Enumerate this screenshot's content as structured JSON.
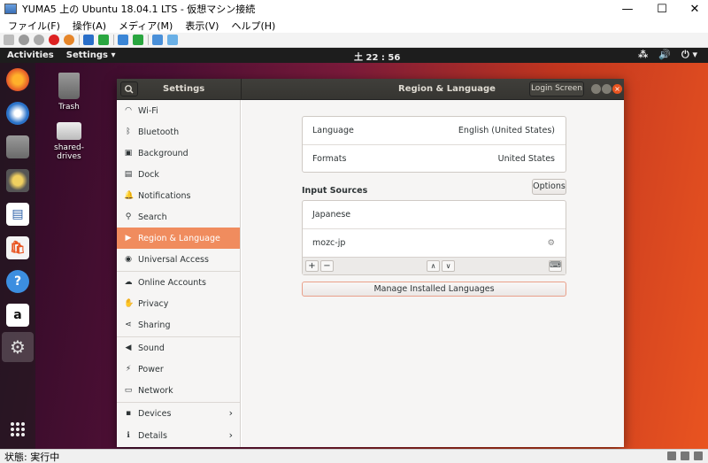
{
  "host": {
    "title": "YUMA5 上の Ubuntu 18.04.1 LTS - 仮想マシン接続",
    "menu": [
      "ファイル(F)",
      "操作(A)",
      "メディア(M)",
      "表示(V)",
      "ヘルプ(H)"
    ],
    "status": "状態: 実行中",
    "window_controls": {
      "minimize": "—",
      "maximize": "☐",
      "close": "✕"
    }
  },
  "topbar": {
    "activities": "Activities",
    "app_menu": "Settings ▾",
    "clock": "土 22 : 56",
    "tray_icons": [
      "network-icon",
      "volume-icon",
      "power-icon"
    ],
    "tray_glyphs": [
      "⁂",
      "🔊",
      "⏻ ▾"
    ]
  },
  "desktop_icons": [
    {
      "name": "trash",
      "label": "Trash"
    },
    {
      "name": "shared-drives",
      "label": "shared-\ndrives"
    }
  ],
  "settings": {
    "header_title": "Settings",
    "panel_title": "Region & Language",
    "login_screen_button": "Login Screen",
    "sidebar": [
      {
        "label": "Wi-Fi",
        "icon": "wifi-icon",
        "glyph": "◠"
      },
      {
        "label": "Bluetooth",
        "icon": "bluetooth-icon",
        "glyph": "ᛒ"
      },
      {
        "label": "Background",
        "icon": "background-icon",
        "glyph": "▣"
      },
      {
        "label": "Dock",
        "icon": "dock-icon",
        "glyph": "▤"
      },
      {
        "label": "Notifications",
        "icon": "notifications-icon",
        "glyph": "🔔"
      },
      {
        "label": "Search",
        "icon": "search-icon",
        "glyph": "⚲"
      },
      {
        "label": "Region & Language",
        "icon": "region-icon",
        "glyph": "▶",
        "selected": true
      },
      {
        "label": "Universal Access",
        "icon": "universal-access-icon",
        "glyph": "◉"
      },
      {
        "label": "Online Accounts",
        "icon": "online-accounts-icon",
        "glyph": "☁"
      },
      {
        "label": "Privacy",
        "icon": "privacy-icon",
        "glyph": "✋"
      },
      {
        "label": "Sharing",
        "icon": "sharing-icon",
        "glyph": "⋖"
      },
      {
        "label": "Sound",
        "icon": "sound-icon",
        "glyph": "◀"
      },
      {
        "label": "Power",
        "icon": "power-icon",
        "glyph": "⚡"
      },
      {
        "label": "Network",
        "icon": "network-icon",
        "glyph": "▭"
      },
      {
        "label": "Devices",
        "icon": "devices-icon",
        "glyph": "▪",
        "chevron": true
      },
      {
        "label": "Details",
        "icon": "details-icon",
        "glyph": "ℹ",
        "chevron": true
      }
    ],
    "language": {
      "label": "Language",
      "value": "English (United States)"
    },
    "formats": {
      "label": "Formats",
      "value": "United States"
    },
    "input_sources_title": "Input Sources",
    "options_button": "Options",
    "input_sources": [
      {
        "label": "Japanese"
      },
      {
        "label": "mozc-jp",
        "settings_icon": "⚙"
      }
    ],
    "toolbar": {
      "add": "+",
      "remove": "−",
      "up": "∧",
      "down": "∨",
      "keyboard": "⌨"
    },
    "manage_button": "Manage Installed Languages"
  },
  "colors": {
    "accent": "#e95420",
    "selected_row": "#f08c5e"
  }
}
